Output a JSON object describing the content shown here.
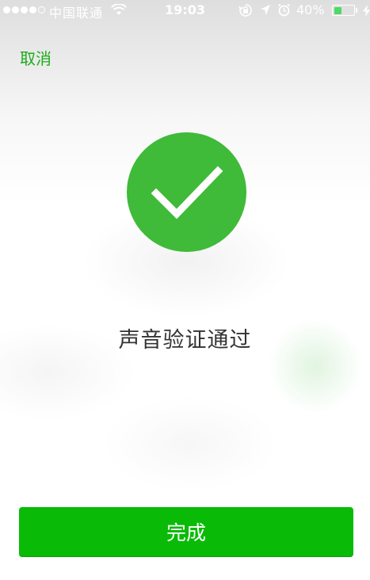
{
  "status_bar": {
    "carrier": "中国联通",
    "time": "19:03",
    "battery_percent": "40%",
    "battery_level": 0.4,
    "signal_bars_filled": 4,
    "signal_bars_total": 5,
    "icons": [
      "wifi-icon",
      "rotation-lock-icon",
      "location-icon",
      "alarm-icon",
      "battery-icon",
      "charging-icon"
    ]
  },
  "nav": {
    "cancel_label": "取消"
  },
  "result": {
    "icon": "checkmark-icon",
    "message": "声音验证通过"
  },
  "actions": {
    "done_label": "完成"
  },
  "colors": {
    "accent": "#1aad19",
    "success_circle": "#3fba39",
    "button": "#09bb07",
    "text": "#333333"
  }
}
